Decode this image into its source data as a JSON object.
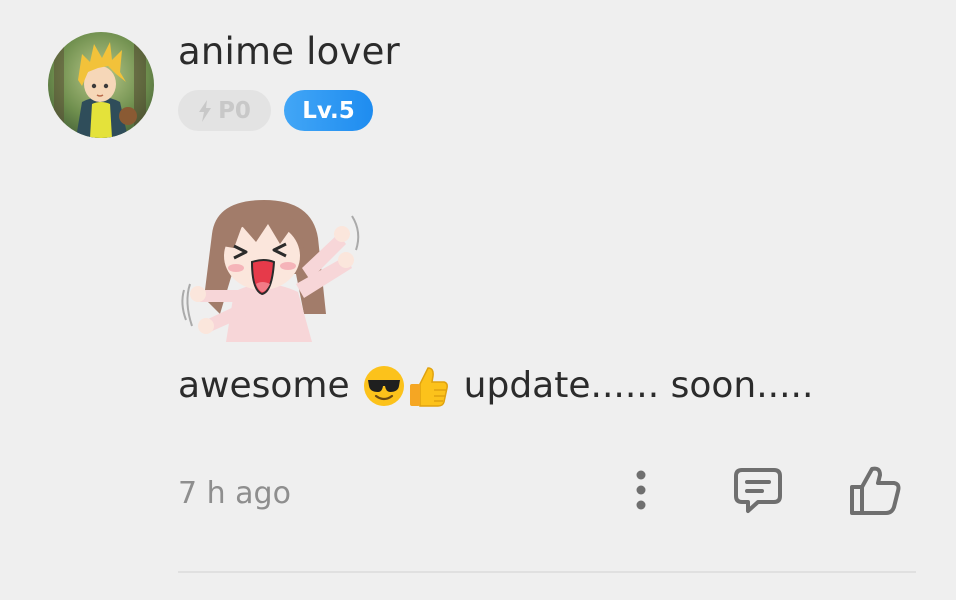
{
  "comment": {
    "username": "anime lover",
    "badges": {
      "points": "P0",
      "level": "Lv.5"
    },
    "text_part1": "awesome",
    "emojis": [
      "sunglasses-face",
      "thumbs-up"
    ],
    "text_part2": "update...... soon.....",
    "timestamp": "7 h ago"
  },
  "colors": {
    "background": "#efefef",
    "level_badge": "#2b95f2",
    "points_badge": "#e3e3e3",
    "text": "#2b2b2b",
    "muted_text": "#8e8e8e",
    "icon": "#6f6f6f"
  },
  "icons": {
    "more": "vertical-dots-icon",
    "reply": "comment-bubble-icon",
    "like": "thumbs-up-icon"
  }
}
